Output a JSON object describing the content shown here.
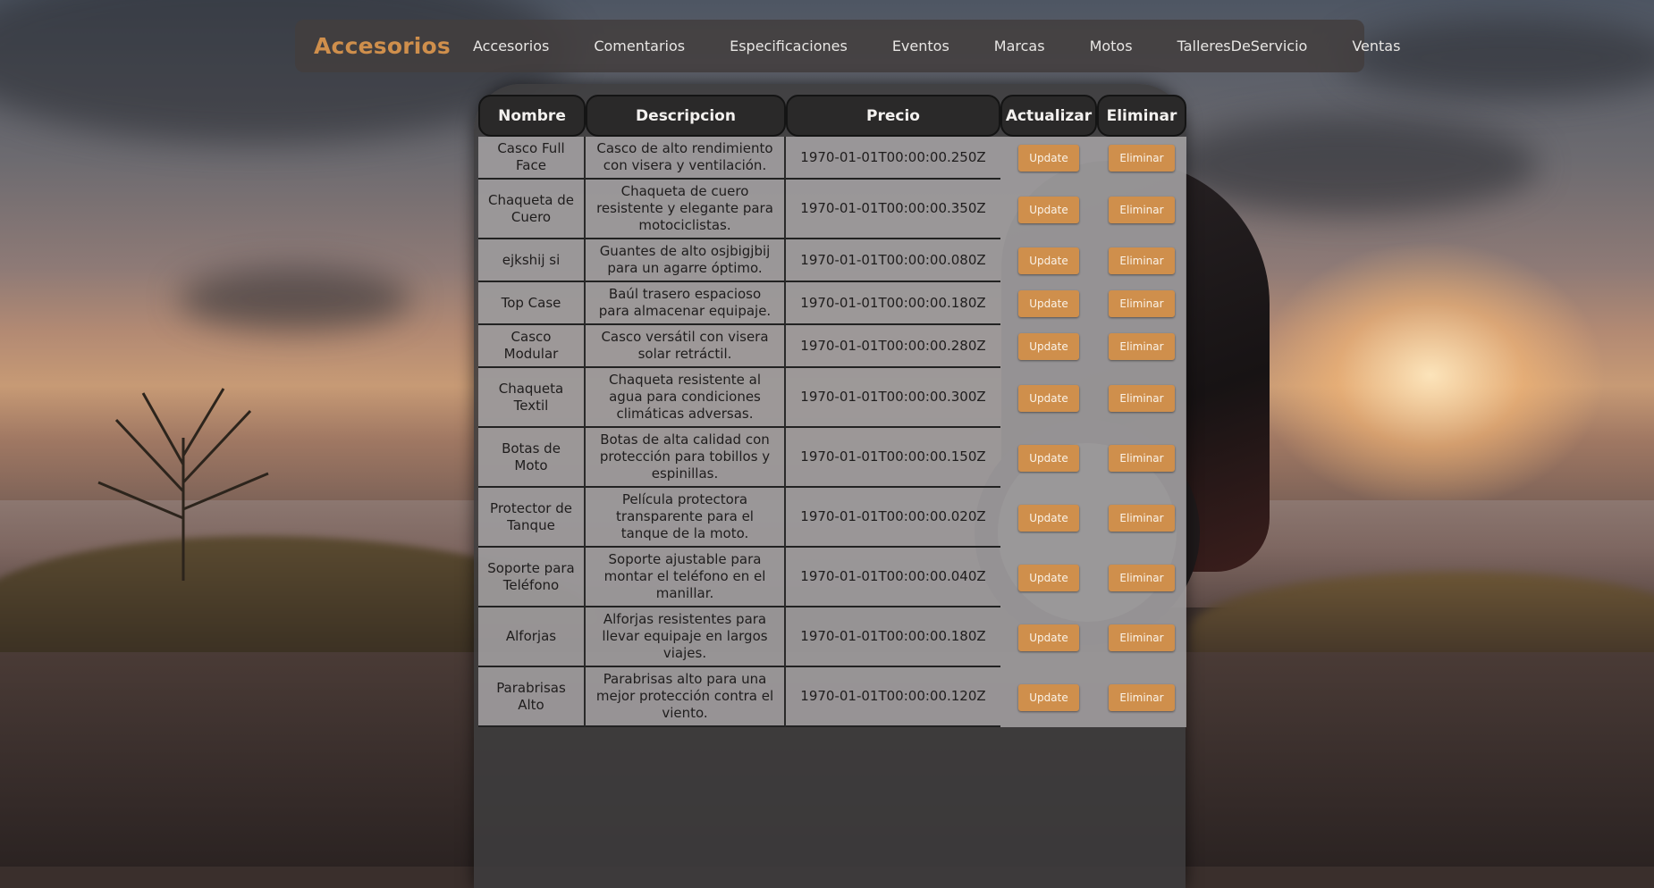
{
  "nav": {
    "brand": "Accesorios",
    "links": [
      "Accesorios",
      "Comentarios",
      "Especificaciones",
      "Eventos",
      "Marcas",
      "Motos",
      "TalleresDeServicio",
      "Ventas"
    ]
  },
  "table": {
    "headers": {
      "nombre": "Nombre",
      "descripcion": "Descripcion",
      "precio": "Precio",
      "actualizar": "Actualizar",
      "eliminar": "Eliminar"
    },
    "update_label": "Update",
    "delete_label": "Eliminar",
    "rows": [
      {
        "nombre": "Casco Full Face",
        "descripcion": "Casco de alto rendimiento con visera y ventilación.",
        "precio": "1970-01-01T00:00:00.250Z"
      },
      {
        "nombre": "Chaqueta de Cuero",
        "descripcion": "Chaqueta de cuero resistente y elegante para motociclistas.",
        "precio": "1970-01-01T00:00:00.350Z"
      },
      {
        "nombre": "ejkshij si",
        "descripcion": "Guantes de alto osjbigjbij para un agarre óptimo.",
        "precio": "1970-01-01T00:00:00.080Z"
      },
      {
        "nombre": "Top Case",
        "descripcion": "Baúl trasero espacioso para almacenar equipaje.",
        "precio": "1970-01-01T00:00:00.180Z"
      },
      {
        "nombre": "Casco Modular",
        "descripcion": "Casco versátil con visera solar retráctil.",
        "precio": "1970-01-01T00:00:00.280Z"
      },
      {
        "nombre": "Chaqueta Textil",
        "descripcion": "Chaqueta resistente al agua para condiciones climáticas adversas.",
        "precio": "1970-01-01T00:00:00.300Z"
      },
      {
        "nombre": "Botas de Moto",
        "descripcion": "Botas de alta calidad con protección para tobillos y espinillas.",
        "precio": "1970-01-01T00:00:00.150Z"
      },
      {
        "nombre": "Protector de Tanque",
        "descripcion": "Película protectora transparente para el tanque de la moto.",
        "precio": "1970-01-01T00:00:00.020Z"
      },
      {
        "nombre": "Soporte para Teléfono",
        "descripcion": "Soporte ajustable para montar el teléfono en el manillar.",
        "precio": "1970-01-01T00:00:00.040Z"
      },
      {
        "nombre": "Alforjas",
        "descripcion": "Alforjas resistentes para llevar equipaje en largos viajes.",
        "precio": "1970-01-01T00:00:00.180Z"
      },
      {
        "nombre": "Parabrisas Alto",
        "descripcion": "Parabrisas alto para una mejor protección contra el viento.",
        "precio": "1970-01-01T00:00:00.120Z"
      }
    ]
  },
  "colors": {
    "accent": "#cf8f4c",
    "nav_bg": "#423e3e",
    "header_bg": "#2a2929"
  }
}
